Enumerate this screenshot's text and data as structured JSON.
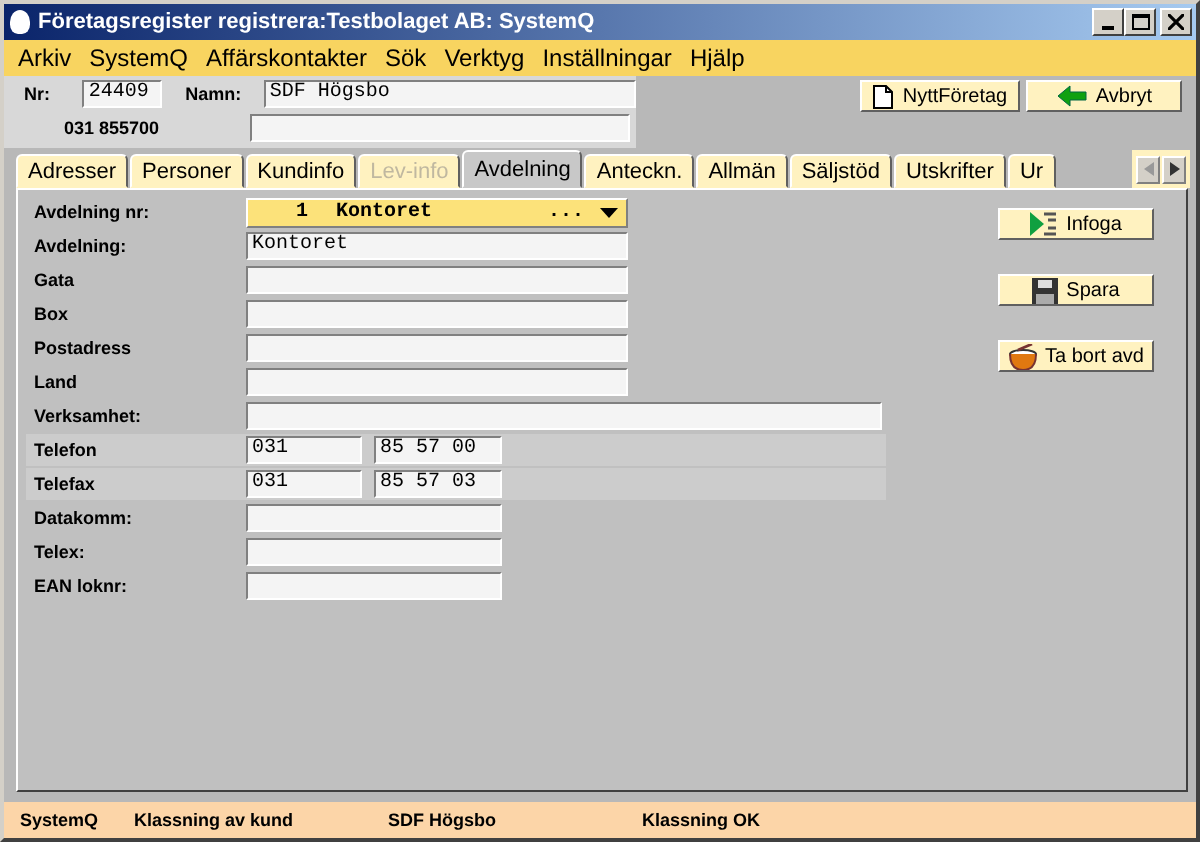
{
  "window": {
    "title": "Företagsregister registrera:Testbolaget AB: SystemQ"
  },
  "menu": [
    "Arkiv",
    "SystemQ",
    "Affärskontakter",
    "Sök",
    "Verktyg",
    "Inställningar",
    "Hjälp"
  ],
  "header": {
    "nr_label": "Nr:",
    "nr_value": "24409",
    "name_label": "Namn:",
    "name_value": "SDF Högsbo",
    "phone": "031 855700"
  },
  "header_buttons": [
    {
      "label": "NyttFöretag",
      "kind": "new"
    },
    {
      "label": "Avbryt",
      "kind": "cancel"
    }
  ],
  "tabs": [
    {
      "label": "Adresser",
      "selected": false,
      "disabled": false
    },
    {
      "label": "Personer",
      "selected": false,
      "disabled": false
    },
    {
      "label": "Kundinfo",
      "selected": false,
      "disabled": false
    },
    {
      "label": "Lev-info",
      "selected": false,
      "disabled": true
    },
    {
      "label": "Avdelning",
      "selected": true,
      "disabled": false
    },
    {
      "label": "Anteckn.",
      "selected": false,
      "disabled": false
    },
    {
      "label": "Allmän",
      "selected": false,
      "disabled": false
    },
    {
      "label": "Säljstöd",
      "selected": false,
      "disabled": false
    },
    {
      "label": "Utskrifter",
      "selected": false,
      "disabled": false
    },
    {
      "label": "Ur",
      "selected": false,
      "disabled": false
    }
  ],
  "form": [
    {
      "label": "Avdelning nr:",
      "kind": "dropdown",
      "number": "1",
      "value": "Kontoret",
      "more": "..."
    },
    {
      "label": "Avdelning:",
      "kind": "text",
      "value": "Kontoret"
    },
    {
      "label": "Gata",
      "kind": "text"
    },
    {
      "label": "Box",
      "kind": "text"
    },
    {
      "label": "Postadress",
      "kind": "text"
    },
    {
      "label": "Land",
      "kind": "text"
    },
    {
      "label": "Verksamhet:",
      "kind": "wide"
    },
    {
      "label": "Telefon",
      "kind": "phone",
      "area": "031",
      "number": "85 57 00"
    },
    {
      "label": "Telefax",
      "kind": "phone",
      "area": "031",
      "number": "85 57 03"
    },
    {
      "label": "Datakomm:",
      "kind": "short"
    },
    {
      "label": "Telex:",
      "kind": "short"
    },
    {
      "label": "EAN loknr:",
      "kind": "short"
    }
  ],
  "side_buttons": [
    {
      "label": "Infoga",
      "kind": "insert"
    },
    {
      "label": "Spara",
      "kind": "save"
    },
    {
      "label": "Ta bort avd",
      "kind": "delete"
    }
  ],
  "status_bar": [
    "SystemQ",
    "Klassning av kund",
    "SDF Högsbo",
    "Klassning OK"
  ]
}
